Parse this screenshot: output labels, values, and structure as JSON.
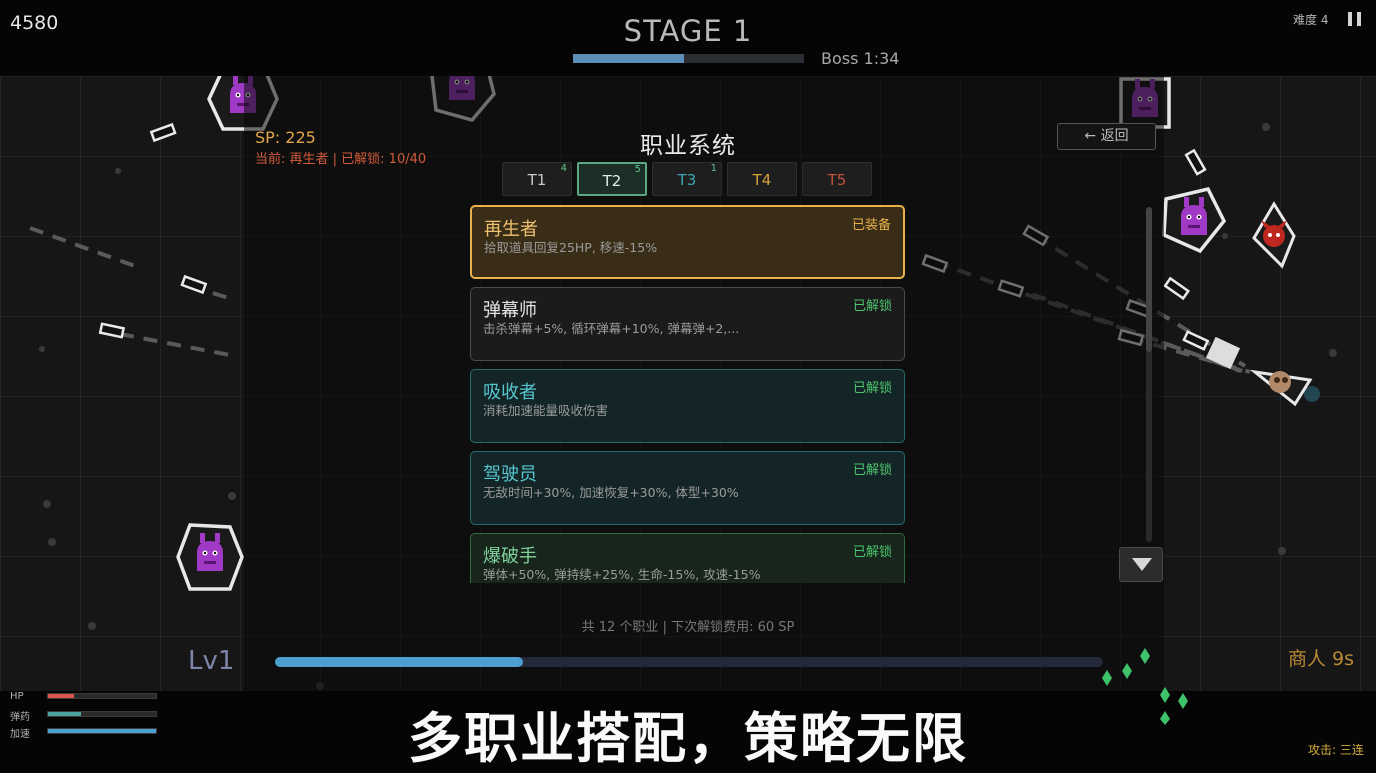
{
  "hud": {
    "score": "4580",
    "stage_title": "STAGE 1",
    "stage_progress": 0.48,
    "boss_timer": "Boss 1:34",
    "difficulty": "难度 4"
  },
  "class_panel": {
    "sp": "SP: 225",
    "current": "当前: 再生者 | 已解锁: 10/40",
    "title": "职业系统",
    "back_label": "← 返回",
    "tabs": [
      {
        "label": "T1",
        "count": "4",
        "color": "#c9c9c9",
        "count_color": "#5ec58a"
      },
      {
        "label": "T2",
        "count": "5",
        "color": "#d9f1e6",
        "count_color": "#5ec58a"
      },
      {
        "label": "T3",
        "count": "1",
        "color": "#3fa7b4",
        "count_color": "#5ec58a"
      },
      {
        "label": "T4",
        "count": "",
        "color": "#d6a33a",
        "count_color": "#5ec58a"
      },
      {
        "label": "T5",
        "count": "",
        "color": "#c0523a",
        "count_color": "#5ec58a"
      }
    ],
    "classes": [
      {
        "name": "再生者",
        "status": "已装备",
        "desc": "拾取道具回复25HP, 移速-15%"
      },
      {
        "name": "弹幕师",
        "status": "已解锁",
        "desc": "击杀弹幕+5%, 循环弹幕+10%, 弹幕弹+2,..."
      },
      {
        "name": "吸收者",
        "status": "已解锁",
        "desc": "消耗加速能量吸收伤害"
      },
      {
        "name": "驾驶员",
        "status": "已解锁",
        "desc": "无敌时间+30%, 加速恢复+30%, 体型+30%"
      },
      {
        "name": "爆破手",
        "status": "已解锁",
        "desc": "弹体+50%, 弹持续+25%, 生命-15%, 攻速-15%"
      }
    ],
    "footer": "共 12 个职业 | 下次解锁费用: 60 SP"
  },
  "player": {
    "level": "Lv1",
    "xp_progress": 0.3,
    "merchant": "商人 9s",
    "stats": [
      {
        "label": "HP",
        "value": 0.24,
        "color": "#d9534f"
      },
      {
        "label": "弹药",
        "value": 0.31,
        "color": "#4aa3a0"
      },
      {
        "label": "加速",
        "value": 1.0,
        "color": "#4e9fd1"
      }
    ],
    "attack_mode": "攻击: 三连"
  },
  "caption": "多职业搭配，策略无限",
  "icons": [
    "pause-icon",
    "back-arrow-icon",
    "chevron-down-icon",
    "purple-monster-icon",
    "red-demon-icon",
    "player-ship-icon",
    "xp-gem-icon"
  ]
}
